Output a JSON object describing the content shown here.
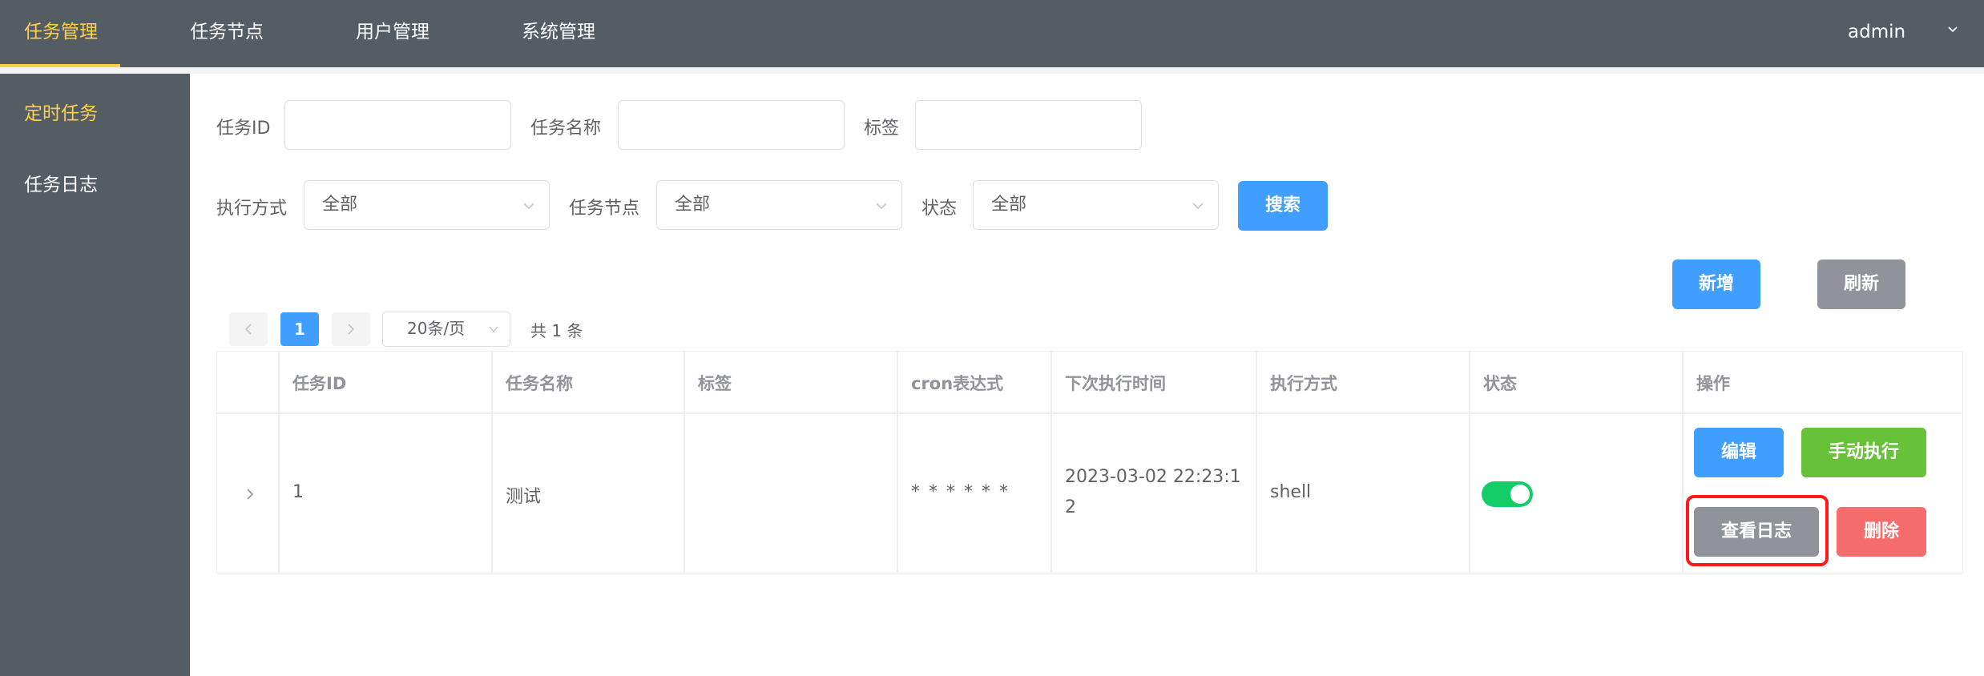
{
  "topnav": {
    "items": [
      "任务管理",
      "任务节点",
      "用户管理",
      "系统管理"
    ],
    "user": "admin"
  },
  "sidebar": {
    "items": [
      "定时任务",
      "任务日志"
    ]
  },
  "filters": {
    "task_id_label": "任务ID",
    "task_name_label": "任务名称",
    "tag_label": "标签",
    "exec_mode_label": "执行方式",
    "exec_mode_value": "全部",
    "node_label": "任务节点",
    "node_value": "全部",
    "status_label": "状态",
    "status_value": "全部",
    "search_button": "搜索"
  },
  "actions": {
    "add_button": "新增",
    "refresh_button": "刷新"
  },
  "pagination": {
    "current_page": "1",
    "page_size": "20条/页",
    "total": "共 1 条"
  },
  "table": {
    "columns": [
      "任务ID",
      "任务名称",
      "标签",
      "cron表达式",
      "下次执行时间",
      "执行方式",
      "状态",
      "操作"
    ],
    "rows": [
      {
        "id": "1",
        "name": "测试",
        "tag": "",
        "cron": "* * * * * *",
        "next_time_line1": "2023-03-02 22:23:1",
        "next_time_line2": "2",
        "exec_mode": "shell",
        "enabled": true,
        "btn_edit": "编辑",
        "btn_run": "手动执行",
        "btn_log": "查看日志",
        "btn_delete": "删除"
      }
    ]
  },
  "colors": {
    "nav_bg": "#545c64",
    "nav_active": "#ffd04b",
    "primary": "#409eff",
    "success": "#67c23a",
    "danger": "#f56c6c",
    "info": "#909399",
    "switch_on": "#13ce66",
    "highlight": "#ff1a1a"
  }
}
